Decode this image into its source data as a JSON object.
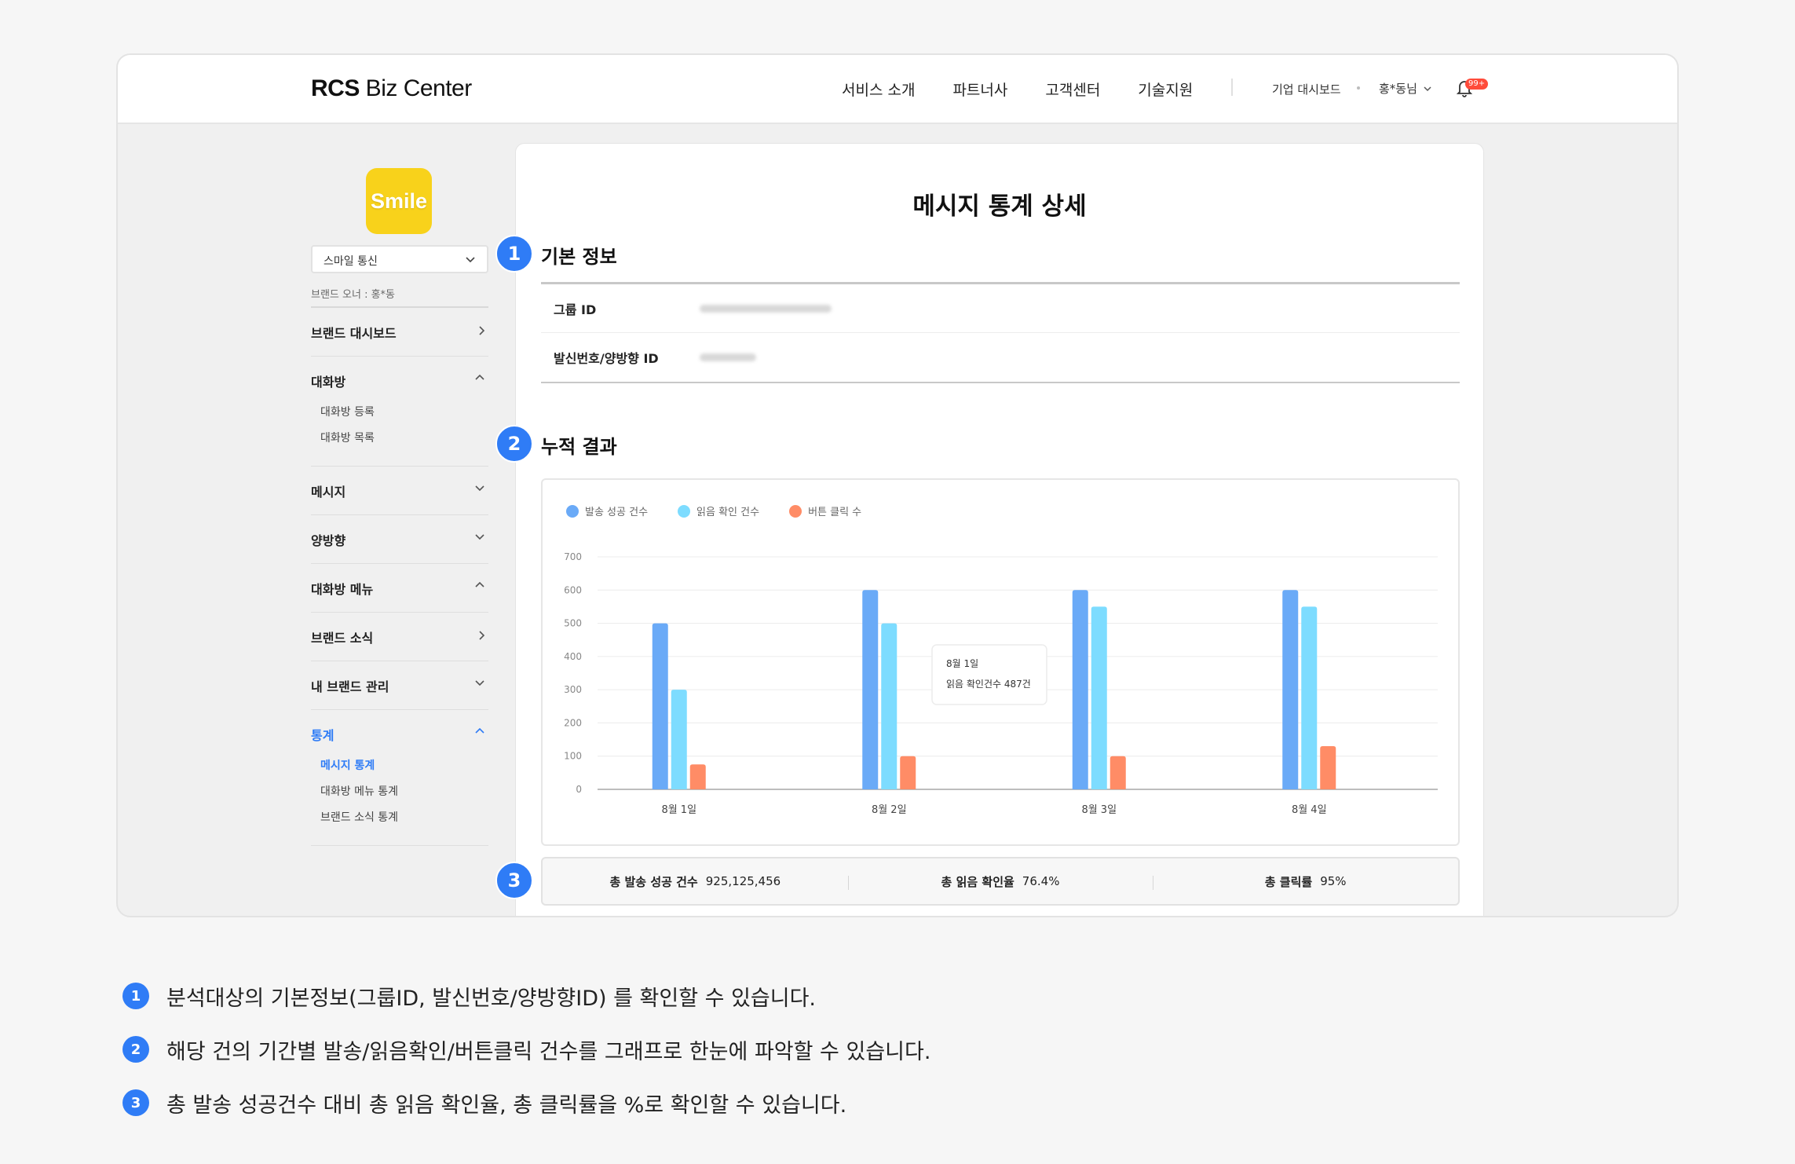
{
  "header": {
    "logo_bold": "RCS",
    "logo_rest": " Biz Center",
    "nav": [
      "서비스 소개",
      "파트너사",
      "고객센터",
      "기술지원"
    ],
    "dashboard_link": "기업 대시보드",
    "user_name": "홍*동님",
    "notif_badge": "99+"
  },
  "sidebar": {
    "brand_logo_text": "Smile",
    "brand_select": "스마일 통신",
    "brand_owner": "브랜드 오너 : 홍*동",
    "sections": [
      {
        "title": "브랜드 대시보드",
        "icon": "chevron-right-icon",
        "items": []
      },
      {
        "title": "대화방",
        "icon": "chevron-up-icon",
        "items": [
          "대화방 등록",
          "대화방 목록"
        ]
      },
      {
        "title": "메시지",
        "icon": "chevron-down-icon",
        "items": []
      },
      {
        "title": "양방향",
        "icon": "chevron-down-icon",
        "items": []
      },
      {
        "title": "대화방 메뉴",
        "icon": "chevron-up-icon",
        "items": []
      },
      {
        "title": "브랜드 소식",
        "icon": "chevron-right-icon",
        "items": []
      },
      {
        "title": "내 브랜드 관리",
        "icon": "chevron-down-icon",
        "items": []
      },
      {
        "title": "통계",
        "icon": "chevron-up-icon",
        "active": true,
        "items": [
          "메시지 통계",
          "대화방 메뉴 통계",
          "브랜드 소식 통계"
        ],
        "active_item": "메시지 통계"
      }
    ]
  },
  "main": {
    "title": "메시지 통계 상세",
    "section1_num": "1",
    "section1_title": "기본 정보",
    "info_rows": [
      {
        "label": "그룹 ID"
      },
      {
        "label": "발신번호/양방향 ID"
      }
    ],
    "section2_num": "2",
    "section2_title": "누적 결과",
    "section3_num": "3",
    "summary": [
      {
        "label": "총 발송 성공 건수",
        "value": "925,125,456"
      },
      {
        "label": "총 읽음 확인율",
        "value": "76.4%"
      },
      {
        "label": "총 클릭률",
        "value": "95%"
      }
    ],
    "tooltip": {
      "line1": "8월 1일",
      "line2": "읽음 확인건수 487건"
    }
  },
  "chart_data": {
    "type": "bar",
    "categories": [
      "8월 1일",
      "8월 2일",
      "8월 3일",
      "8월 4일"
    ],
    "series": [
      {
        "name": "발송 성공 건수",
        "color": "#6aaaf7",
        "values": [
          500,
          600,
          600,
          600
        ]
      },
      {
        "name": "읽음 확인 건수",
        "color": "#7ddcff",
        "values": [
          300,
          500,
          550,
          550
        ]
      },
      {
        "name": "버튼 클릭 수",
        "color": "#ff8c66",
        "values": [
          75,
          100,
          100,
          130
        ]
      }
    ],
    "yticks": [
      0,
      100,
      200,
      300,
      400,
      500,
      600,
      700
    ],
    "ylim": [
      0,
      700
    ],
    "grid": true,
    "legend_position": "top-left"
  },
  "notes": [
    {
      "num": "1",
      "text": "분석대상의 기본정보(그룹ID, 발신번호/양방향ID) 를 확인할 수 있습니다."
    },
    {
      "num": "2",
      "text": "해당 건의 기간별 발송/읽음확인/버튼클릭 건수를 그래프로 한눈에 파악할 수 있습니다."
    },
    {
      "num": "3",
      "text": "총 발송 성공건수 대비 총 읽음 확인율, 총 클릭률을 %로 확인할 수 있습니다."
    }
  ]
}
